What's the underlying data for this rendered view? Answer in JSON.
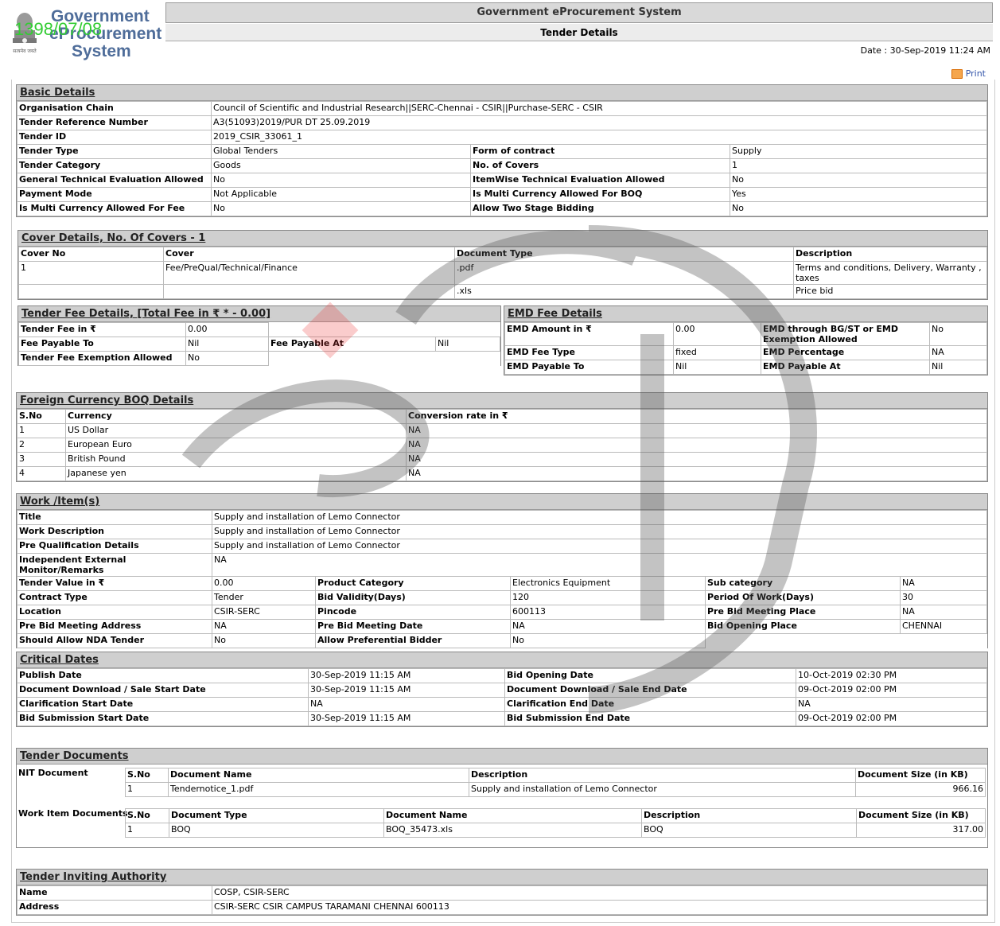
{
  "branding": {
    "logo_line1": "Government",
    "logo_line2": "eProcurement",
    "logo_line3": "System",
    "overlay_text": "1398/07/08",
    "emblem_caption": "सत्यमेव जयते"
  },
  "header": {
    "title": "Government eProcurement System",
    "subtitle": "Tender Details",
    "date_text": "Date : 30-Sep-2019 11:24 AM",
    "print_label": "Print"
  },
  "basic": {
    "title": "Basic Details",
    "rows": [
      [
        "Organisation Chain",
        "Council of Scientific and Industrial Research||SERC-Chennai - CSIR||Purchase-SERC - CSIR"
      ],
      [
        "Tender Reference Number",
        "A3(51093)2019/PUR DT 25.09.2019"
      ],
      [
        "Tender ID",
        "2019_CSIR_33061_1"
      ]
    ],
    "pairs": [
      [
        "Tender Type",
        "Global Tenders",
        "Form of contract",
        "Supply"
      ],
      [
        "Tender Category",
        "Goods",
        "No. of Covers",
        "1"
      ],
      [
        "General Technical Evaluation Allowed",
        "No",
        "ItemWise Technical Evaluation Allowed",
        "No"
      ],
      [
        "Payment Mode",
        "Not Applicable",
        "Is Multi Currency Allowed For BOQ",
        "Yes"
      ],
      [
        "Is Multi Currency Allowed For Fee",
        "No",
        "Allow Two Stage Bidding",
        "No"
      ]
    ]
  },
  "cover": {
    "title": "Cover Details, No. Of Covers - 1",
    "headers": [
      "Cover No",
      "Cover",
      "Document Type",
      "Description"
    ],
    "rows": [
      [
        "1",
        "Fee/PreQual/Technical/Finance",
        ".pdf",
        "Terms and conditions, Delivery, Warranty , taxes"
      ],
      [
        "",
        "",
        ".xls",
        "Price bid"
      ]
    ]
  },
  "fee": {
    "title": "Tender Fee Details, [Total Fee in ₹ * - 0.00]",
    "fee_in_label": "Tender Fee in ₹",
    "fee_in_value": "0.00",
    "payable_to_label": "Fee Payable To",
    "payable_to_value": "Nil",
    "payable_at_label": "Fee Payable At",
    "payable_at_value": "Nil",
    "exemption_label": "Tender Fee Exemption Allowed",
    "exemption_value": "No"
  },
  "emd": {
    "title": "EMD Fee Details",
    "rows": [
      [
        "EMD Amount in ₹",
        "0.00",
        "EMD through BG/ST or EMD Exemption Allowed",
        "No"
      ],
      [
        "EMD Fee Type",
        "fixed",
        "EMD Percentage",
        "NA"
      ],
      [
        "EMD Payable To",
        "Nil",
        "EMD Payable At",
        "Nil"
      ]
    ]
  },
  "foreign": {
    "title": "Foreign Currency BOQ Details",
    "headers": [
      "S.No",
      "Currency",
      "Conversion rate in ₹"
    ],
    "rows": [
      [
        "1",
        "US Dollar",
        "NA"
      ],
      [
        "2",
        "European Euro",
        "NA"
      ],
      [
        "3",
        "British Pound",
        "NA"
      ],
      [
        "4",
        "Japanese yen",
        "NA"
      ]
    ]
  },
  "work": {
    "title": "Work /Item(s)",
    "rows": [
      [
        "Title",
        "Supply and installation of Lemo Connector"
      ],
      [
        "Work Description",
        "Supply and installation of Lemo Connector"
      ],
      [
        "Pre Qualification Details",
        "Supply and installation of Lemo Connector"
      ],
      [
        "Independent External Monitor/Remarks",
        "NA"
      ]
    ],
    "triples": [
      [
        "Tender Value in ₹",
        "0.00",
        "Product Category",
        "Electronics Equipment",
        "Sub category",
        "NA"
      ],
      [
        "Contract Type",
        "Tender",
        "Bid Validity(Days)",
        "120",
        "Period Of Work(Days)",
        "30"
      ],
      [
        "Location",
        "CSIR-SERC",
        "Pincode",
        "600113",
        "Pre Bid Meeting Place",
        "NA"
      ],
      [
        "Pre Bid Meeting Address",
        "NA",
        "Pre Bid Meeting Date",
        "NA",
        "Bid Opening Place",
        "CHENNAI"
      ]
    ],
    "last": [
      "Should Allow NDA Tender",
      "No",
      "Allow Preferential Bidder",
      "No"
    ]
  },
  "dates": {
    "title": "Critical Dates",
    "rows": [
      [
        "Publish Date",
        "30-Sep-2019 11:15 AM",
        "Bid Opening Date",
        "10-Oct-2019 02:30 PM"
      ],
      [
        "Document Download / Sale Start Date",
        "30-Sep-2019 11:15 AM",
        "Document Download / Sale End Date",
        "09-Oct-2019 02:00 PM"
      ],
      [
        "Clarification Start Date",
        "NA",
        "Clarification End Date",
        "NA"
      ],
      [
        "Bid Submission Start Date",
        "30-Sep-2019 11:15 AM",
        "Bid Submission End Date",
        "09-Oct-2019 02:00 PM"
      ]
    ]
  },
  "docs": {
    "title": "Tender Documents",
    "nit_label": "NIT Document",
    "nit_headers": [
      "S.No",
      "Document Name",
      "Description",
      "Document Size (in KB)"
    ],
    "nit_row": [
      "1",
      "Tendernotice_1.pdf",
      "Supply and installation of Lemo Connector",
      "966.16"
    ],
    "work_label": "Work Item Documents",
    "work_headers": [
      "S.No",
      "Document Type",
      "Document Name",
      "Description",
      "Document Size (in KB)"
    ],
    "work_row": [
      "1",
      "BOQ",
      "BOQ_35473.xls",
      "BOQ",
      "317.00"
    ]
  },
  "authority": {
    "title": "Tender Inviting Authority",
    "rows": [
      [
        "Name",
        "COSP, CSIR-SERC"
      ],
      [
        "Address",
        "CSIR-SERC CSIR CAMPUS TARAMANI CHENNAI 600113"
      ]
    ]
  }
}
